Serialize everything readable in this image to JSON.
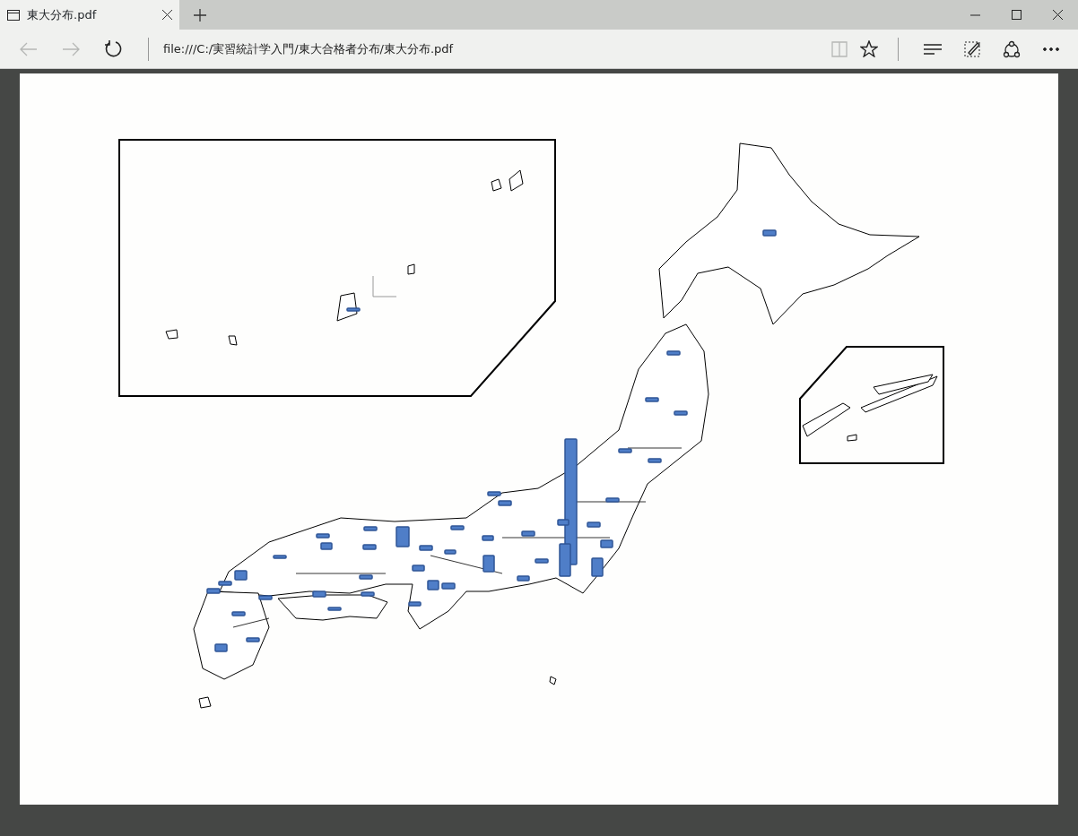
{
  "tab": {
    "title": "東大分布.pdf",
    "selected": true
  },
  "address": "file:///C:/実習統計学入門/東大合格者分布/東大分布.pdf",
  "nav": [
    {
      "kind": "back",
      "disabled": true
    },
    {
      "kind": "forward",
      "disabled": true
    },
    {
      "kind": "refresh",
      "disabled": false
    }
  ],
  "tools": [
    {
      "kind": "reading",
      "disabled": true
    },
    {
      "kind": "favorite",
      "disabled": false
    }
  ],
  "hub": [
    {
      "kind": "hub"
    },
    {
      "kind": "note"
    },
    {
      "kind": "share"
    },
    {
      "kind": "more"
    }
  ]
}
